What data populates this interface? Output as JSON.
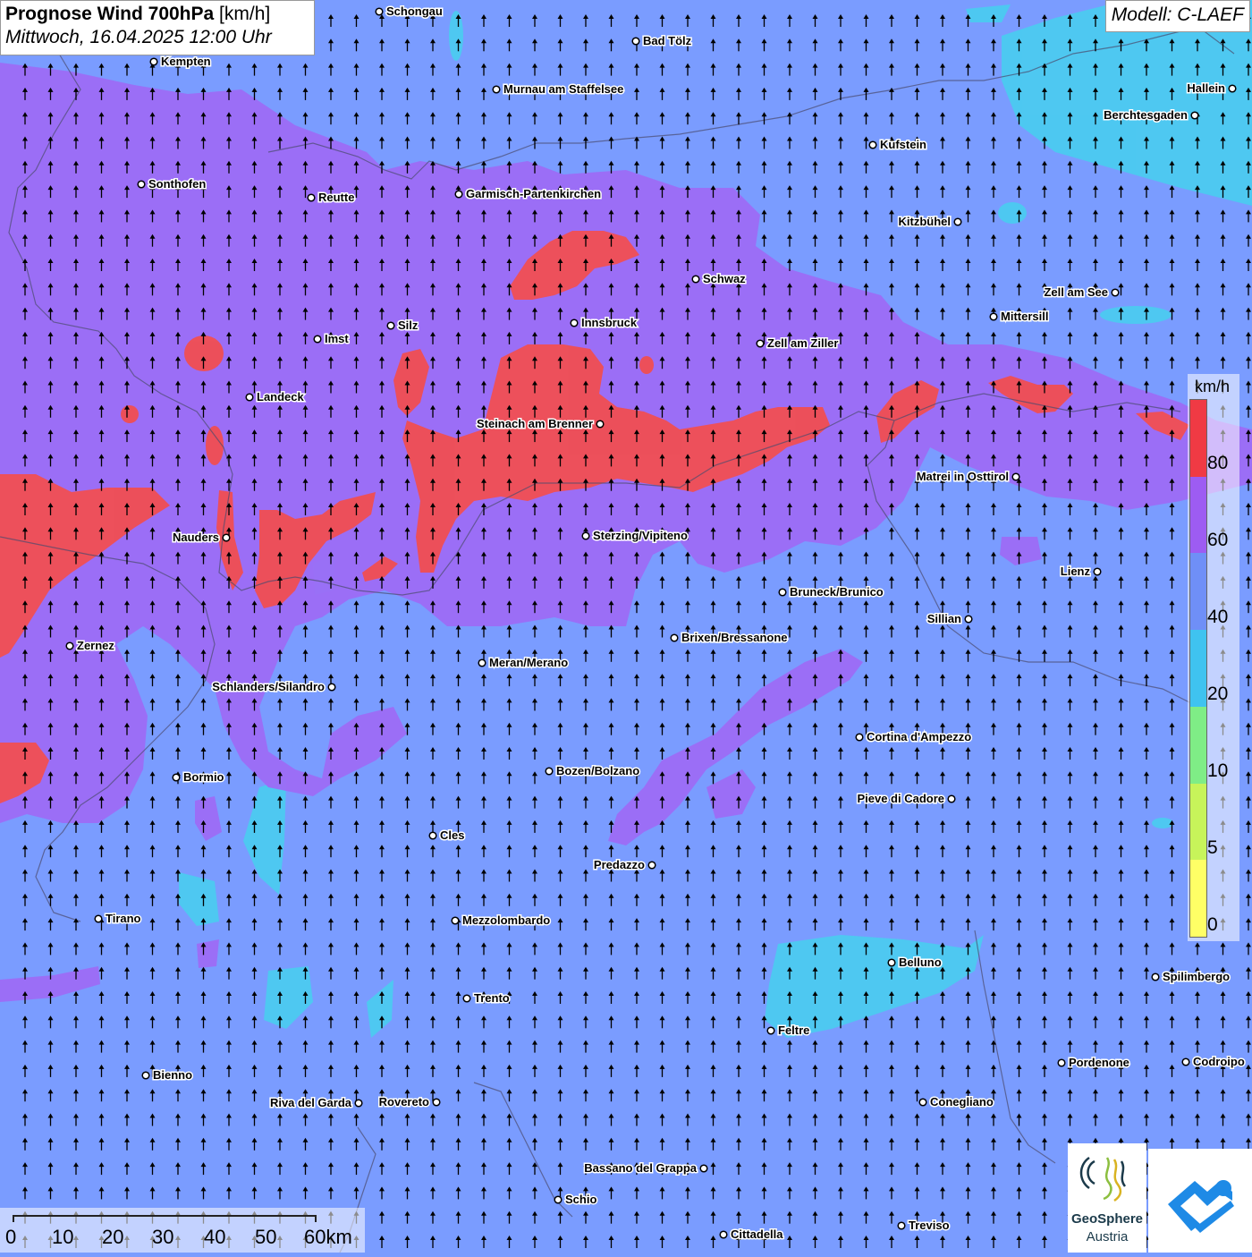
{
  "title": {
    "main": "Prognose Wind 700hPa",
    "unit": "[km/h]",
    "datetime": "Mittwoch, 16.04.2025 12:00 Uhr"
  },
  "model": "Modell: C-LAEF",
  "colors": {
    "base": "#7a9cff",
    "band_60_80": "#9d6cf6",
    "band_80_plus": "#f14e52",
    "band_20_40": "#49cdf0",
    "arrow": "#000000",
    "border": "#555555"
  },
  "legend": {
    "unit": "km/h",
    "ticks": [
      "80",
      "60",
      "40",
      "20",
      "10",
      "5",
      "0"
    ],
    "colors": [
      "#f03a44",
      "#9d5cf2",
      "#6f8ff7",
      "#3fc3f0",
      "#7fed86",
      "#c7f45a",
      "#ffff66"
    ]
  },
  "scale": {
    "labels": [
      "0",
      "10",
      "20",
      "30",
      "40",
      "50",
      "60km"
    ]
  },
  "logo": {
    "line1": "GeoSphere",
    "line2": "Austria",
    "icon": "geosphere-logo-icon"
  },
  "cities": [
    {
      "name": "Schongau"
    },
    {
      "name": "Kempten"
    },
    {
      "name": "Bad Tölz"
    },
    {
      "name": "Murnau am Staffelsee"
    },
    {
      "name": "Hallein"
    },
    {
      "name": "Berchtesgaden"
    },
    {
      "name": "Kufstein"
    },
    {
      "name": "Sonthofen"
    },
    {
      "name": "Reutte"
    },
    {
      "name": "Garmisch-Partenkirchen"
    },
    {
      "name": "Kitzbühel"
    },
    {
      "name": "Schwaz"
    },
    {
      "name": "Zell am See"
    },
    {
      "name": "Mittersill"
    },
    {
      "name": "Silz"
    },
    {
      "name": "Innsbruck"
    },
    {
      "name": "Imst"
    },
    {
      "name": "Zell am Ziller"
    },
    {
      "name": "Landeck"
    },
    {
      "name": "Steinach am Brenner"
    },
    {
      "name": "Matrei in Osttirol"
    },
    {
      "name": "Nauders"
    },
    {
      "name": "Sterzing/Vipiteno"
    },
    {
      "name": "Lienz"
    },
    {
      "name": "Bruneck/Brunico"
    },
    {
      "name": "Sillian"
    },
    {
      "name": "Zernez"
    },
    {
      "name": "Brixen/Bressanone"
    },
    {
      "name": "Meran/Merano"
    },
    {
      "name": "Schlanders/Silandro"
    },
    {
      "name": "Cortina d'Ampezzo"
    },
    {
      "name": "Bormio"
    },
    {
      "name": "Bozen/Bolzano"
    },
    {
      "name": "Pieve di Cadore"
    },
    {
      "name": "Cles"
    },
    {
      "name": "Predazzo"
    },
    {
      "name": "Tirano"
    },
    {
      "name": "Mezzolombardo"
    },
    {
      "name": "Belluno"
    },
    {
      "name": "Spilimbergo"
    },
    {
      "name": "Trento"
    },
    {
      "name": "Feltre"
    },
    {
      "name": "Pordenone"
    },
    {
      "name": "Codroipo"
    },
    {
      "name": "Bienno"
    },
    {
      "name": "Riva del Garda"
    },
    {
      "name": "Rovereto"
    },
    {
      "name": "Conegliano"
    },
    {
      "name": "Bassano del Grappa"
    },
    {
      "name": "Schio"
    },
    {
      "name": "Treviso"
    },
    {
      "name": "Cittadella"
    }
  ]
}
